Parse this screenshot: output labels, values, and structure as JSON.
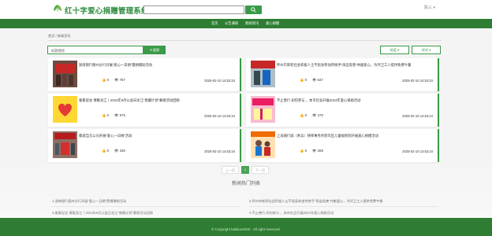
{
  "header": {
    "site_title": "红十字爱心捐赠管理系统",
    "user_name": "陈三",
    "search_placeholder": ""
  },
  "nav": {
    "items": [
      {
        "label": "首页"
      },
      {
        "label": "公告通知"
      },
      {
        "label": "新闻资讯"
      },
      {
        "label": "爱心捐赠"
      }
    ]
  },
  "breadcrumb": "首页 / 新闻资讯",
  "list_search": {
    "input_label": "标题搜索",
    "button_label": "搜索"
  },
  "sort": {
    "heat_label": "热度 ▾",
    "time_label": "时间 ▾"
  },
  "articles": [
    {
      "title": "浙商银行德州分行开展“爱心一日捐”暨捐赠助活动",
      "likes": "0",
      "views": "787",
      "date": "2025-02-10 14:53:24"
    },
    {
      "title": "怀州市新积社会积极人士不屈身参加传统手“再出现善”共献爱心，为环卫工人提供免费午餐",
      "likes": "0",
      "views": "637",
      "date": "2025-02-10 14:53:24"
    },
    {
      "title": "秦篆促会 情暖龙江丨2024年9月公益日龙江“善藏计划”募捐活动回顾",
      "likes": "0",
      "views": "575",
      "date": "2025-02-10 14:53:24"
    },
    {
      "title": "不止善行 如何参与 ，本市社会开展2024年爱心捐助活动",
      "likes": "0",
      "views": "470",
      "date": "2025-02-10 14:53:24"
    },
    {
      "title": "都城当元公司开展“爱心一日捐”活动",
      "likes": "0",
      "views": "336",
      "date": "2025-02-10 14:53:24"
    },
    {
      "title": "上海践行城（青岛）律师事务所到市区儿童福利院开展爱心捐赠活动",
      "likes": "0",
      "views": "269",
      "date": "2025-02-10 14:53:24"
    }
  ],
  "pagination": {
    "prev": "上一页",
    "current": "1",
    "next": "下一页"
  },
  "hot": {
    "title": "新闻热门列表",
    "items": [
      "1.浙商银行德州分行开展“爱心一日捐”暨捐赠助活动",
      "2.怀州市新积社会积极人士不屈身参加传统手“再出现善”共献爱心，为环卫工人提供免费午餐",
      "3.秦篆促会 情暖龙江丨2024年9月公益日龙江“善藏计划”募捐活动回顾",
      "4.不止善行 如何参与 ，本市社会开展2024年爱心捐助活动"
    ]
  },
  "footer": {
    "copyright": "© Copyright bakiluo2020 . All right reserved."
  },
  "colors": {
    "brand_green": "#3a9a47",
    "nav_green": "#2e7d32"
  }
}
